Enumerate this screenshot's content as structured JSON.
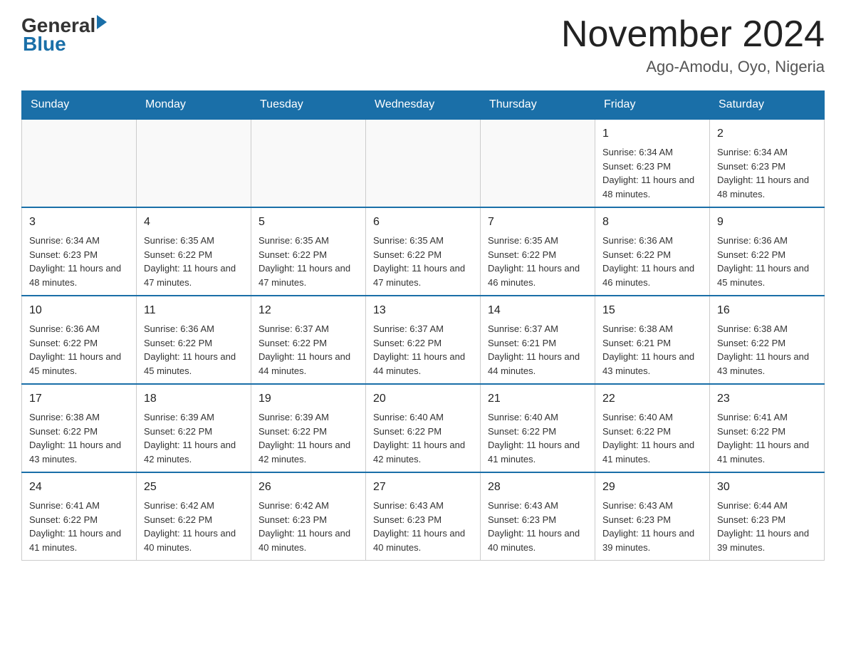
{
  "header": {
    "logo_general": "General",
    "logo_blue": "Blue",
    "month_title": "November 2024",
    "location": "Ago-Amodu, Oyo, Nigeria"
  },
  "days_of_week": [
    "Sunday",
    "Monday",
    "Tuesday",
    "Wednesday",
    "Thursday",
    "Friday",
    "Saturday"
  ],
  "weeks": [
    [
      {
        "day": "",
        "info": ""
      },
      {
        "day": "",
        "info": ""
      },
      {
        "day": "",
        "info": ""
      },
      {
        "day": "",
        "info": ""
      },
      {
        "day": "",
        "info": ""
      },
      {
        "day": "1",
        "info": "Sunrise: 6:34 AM\nSunset: 6:23 PM\nDaylight: 11 hours and 48 minutes."
      },
      {
        "day": "2",
        "info": "Sunrise: 6:34 AM\nSunset: 6:23 PM\nDaylight: 11 hours and 48 minutes."
      }
    ],
    [
      {
        "day": "3",
        "info": "Sunrise: 6:34 AM\nSunset: 6:23 PM\nDaylight: 11 hours and 48 minutes."
      },
      {
        "day": "4",
        "info": "Sunrise: 6:35 AM\nSunset: 6:22 PM\nDaylight: 11 hours and 47 minutes."
      },
      {
        "day": "5",
        "info": "Sunrise: 6:35 AM\nSunset: 6:22 PM\nDaylight: 11 hours and 47 minutes."
      },
      {
        "day": "6",
        "info": "Sunrise: 6:35 AM\nSunset: 6:22 PM\nDaylight: 11 hours and 47 minutes."
      },
      {
        "day": "7",
        "info": "Sunrise: 6:35 AM\nSunset: 6:22 PM\nDaylight: 11 hours and 46 minutes."
      },
      {
        "day": "8",
        "info": "Sunrise: 6:36 AM\nSunset: 6:22 PM\nDaylight: 11 hours and 46 minutes."
      },
      {
        "day": "9",
        "info": "Sunrise: 6:36 AM\nSunset: 6:22 PM\nDaylight: 11 hours and 45 minutes."
      }
    ],
    [
      {
        "day": "10",
        "info": "Sunrise: 6:36 AM\nSunset: 6:22 PM\nDaylight: 11 hours and 45 minutes."
      },
      {
        "day": "11",
        "info": "Sunrise: 6:36 AM\nSunset: 6:22 PM\nDaylight: 11 hours and 45 minutes."
      },
      {
        "day": "12",
        "info": "Sunrise: 6:37 AM\nSunset: 6:22 PM\nDaylight: 11 hours and 44 minutes."
      },
      {
        "day": "13",
        "info": "Sunrise: 6:37 AM\nSunset: 6:22 PM\nDaylight: 11 hours and 44 minutes."
      },
      {
        "day": "14",
        "info": "Sunrise: 6:37 AM\nSunset: 6:21 PM\nDaylight: 11 hours and 44 minutes."
      },
      {
        "day": "15",
        "info": "Sunrise: 6:38 AM\nSunset: 6:21 PM\nDaylight: 11 hours and 43 minutes."
      },
      {
        "day": "16",
        "info": "Sunrise: 6:38 AM\nSunset: 6:22 PM\nDaylight: 11 hours and 43 minutes."
      }
    ],
    [
      {
        "day": "17",
        "info": "Sunrise: 6:38 AM\nSunset: 6:22 PM\nDaylight: 11 hours and 43 minutes."
      },
      {
        "day": "18",
        "info": "Sunrise: 6:39 AM\nSunset: 6:22 PM\nDaylight: 11 hours and 42 minutes."
      },
      {
        "day": "19",
        "info": "Sunrise: 6:39 AM\nSunset: 6:22 PM\nDaylight: 11 hours and 42 minutes."
      },
      {
        "day": "20",
        "info": "Sunrise: 6:40 AM\nSunset: 6:22 PM\nDaylight: 11 hours and 42 minutes."
      },
      {
        "day": "21",
        "info": "Sunrise: 6:40 AM\nSunset: 6:22 PM\nDaylight: 11 hours and 41 minutes."
      },
      {
        "day": "22",
        "info": "Sunrise: 6:40 AM\nSunset: 6:22 PM\nDaylight: 11 hours and 41 minutes."
      },
      {
        "day": "23",
        "info": "Sunrise: 6:41 AM\nSunset: 6:22 PM\nDaylight: 11 hours and 41 minutes."
      }
    ],
    [
      {
        "day": "24",
        "info": "Sunrise: 6:41 AM\nSunset: 6:22 PM\nDaylight: 11 hours and 41 minutes."
      },
      {
        "day": "25",
        "info": "Sunrise: 6:42 AM\nSunset: 6:22 PM\nDaylight: 11 hours and 40 minutes."
      },
      {
        "day": "26",
        "info": "Sunrise: 6:42 AM\nSunset: 6:23 PM\nDaylight: 11 hours and 40 minutes."
      },
      {
        "day": "27",
        "info": "Sunrise: 6:43 AM\nSunset: 6:23 PM\nDaylight: 11 hours and 40 minutes."
      },
      {
        "day": "28",
        "info": "Sunrise: 6:43 AM\nSunset: 6:23 PM\nDaylight: 11 hours and 40 minutes."
      },
      {
        "day": "29",
        "info": "Sunrise: 6:43 AM\nSunset: 6:23 PM\nDaylight: 11 hours and 39 minutes."
      },
      {
        "day": "30",
        "info": "Sunrise: 6:44 AM\nSunset: 6:23 PM\nDaylight: 11 hours and 39 minutes."
      }
    ]
  ]
}
